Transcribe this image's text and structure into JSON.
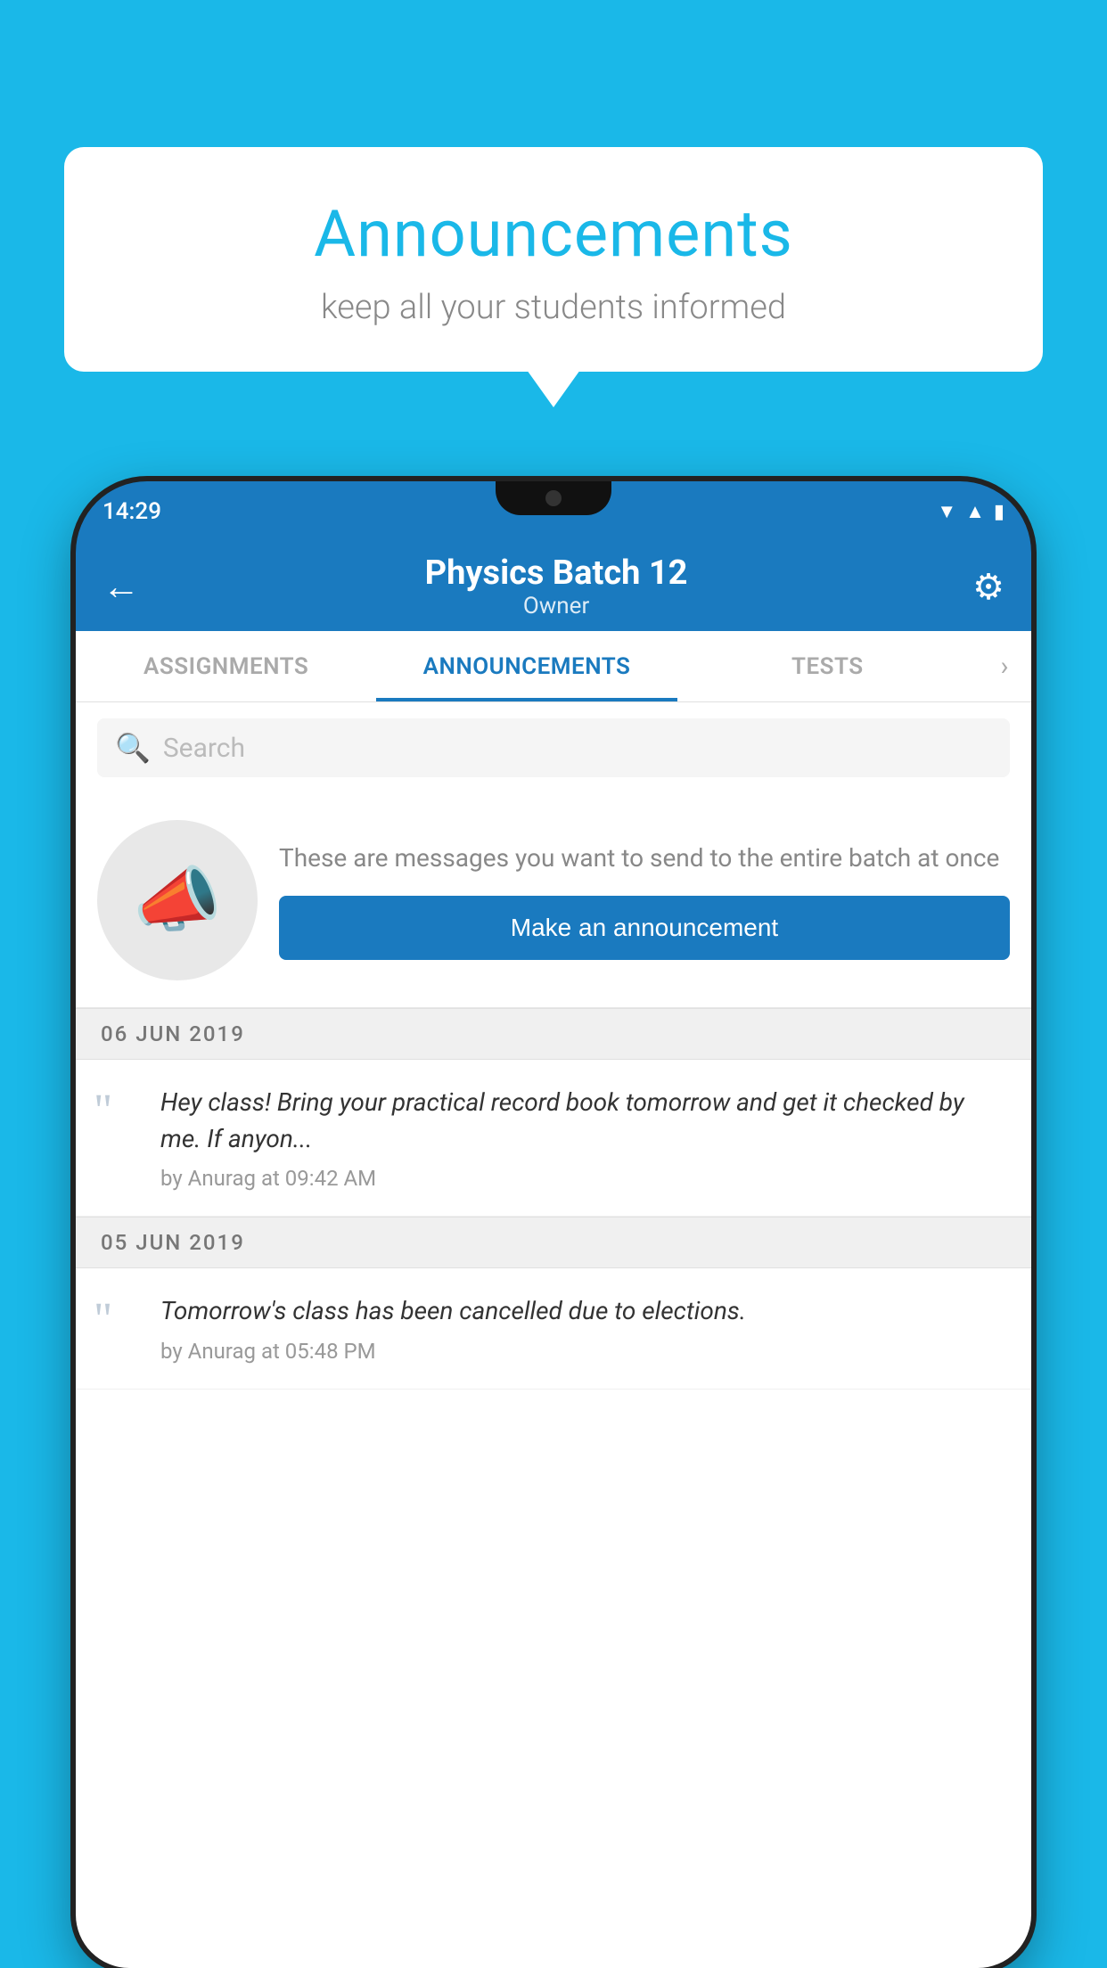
{
  "background_color": "#1ab8e8",
  "bubble": {
    "title": "Announcements",
    "subtitle": "keep all your students informed"
  },
  "phone": {
    "status": {
      "time": "14:29",
      "wifi_icon": "▼",
      "signal_icon": "▲",
      "battery_icon": "▮"
    },
    "app_bar": {
      "back_label": "←",
      "title": "Physics Batch 12",
      "subtitle": "Owner",
      "gear_label": "⚙"
    },
    "tabs": [
      {
        "label": "ASSIGNMENTS",
        "active": false
      },
      {
        "label": "ANNOUNCEMENTS",
        "active": true
      },
      {
        "label": "TESTS",
        "active": false
      }
    ],
    "search": {
      "placeholder": "Search"
    },
    "promo": {
      "description": "These are messages you want to send to the entire batch at once",
      "button_label": "Make an announcement"
    },
    "announcements": [
      {
        "date": "06  JUN  2019",
        "text": "Hey class! Bring your practical record book tomorrow and get it checked by me. If anyon...",
        "author": "by Anurag at 09:42 AM"
      },
      {
        "date": "05  JUN  2019",
        "text": "Tomorrow's class has been cancelled due to elections.",
        "author": "by Anurag at 05:48 PM"
      }
    ]
  }
}
